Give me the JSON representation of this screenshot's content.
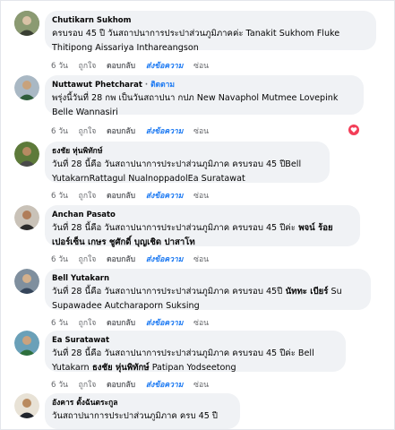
{
  "comments": [
    {
      "name": "Chutikarn Sukhom",
      "follow": "",
      "line1": "ครบรอบ 45 ปี วันสถาปนาการประปาส่วนภูมิภาคค่ะ Tanakit Sukhom Fluke",
      "line2": "Thitipong Aissariya Inthareangson",
      "time": "6 วัน",
      "like": "ถูกใจ",
      "reply": "ตอบกลับ",
      "share": "ส่งข้อความ",
      "hide": "ซ่อน"
    },
    {
      "name": "Nuttawut Phetcharat",
      "follow": "ติดตาม",
      "line1": "พรุ่งนี้วันที่ 28 กพ เป็นวันสถาปนา กปภ New Navaphol Mutmee Lovepink",
      "line2": "Belle Wannasiri",
      "time": "6 วัน",
      "like": "ถูกใจ",
      "reply": "ตอบกลับ",
      "share": "ส่งข้อความ",
      "hide": "ซ่อน"
    },
    {
      "name": "ธงชัย หุ่นพิทักษ์",
      "follow": "",
      "line1": "วันที่ 28 นี้คือ วันสถาปนาการประปาส่วนภูมิภาค ครบรอบ 45 ปีBell",
      "line2": "YutakarnRattagul NualnoppadolEa Suratawat",
      "time": "6 วัน",
      "like": "ถูกใจ",
      "reply": "ตอบกลับ",
      "share": "ส่งข้อความ",
      "hide": "ซ่อน"
    },
    {
      "name": "Anchan Pasato",
      "follow": "",
      "line1": "วันที่ 28 นี้คือ วันสถาปนาการประปาส่วนภูมิภาค ครบรอบ 45 ปีค่ะ",
      "line1_bold": " พจน์ ร้อย",
      "line2": "เปอร์เซ็น เกษร ชูศักดิ์ บุญเชิด ปาสาโท",
      "time": "6 วัน",
      "like": "ถูกใจ",
      "reply": "ตอบกลับ",
      "share": "ส่งข้อความ",
      "hide": "ซ่อน"
    },
    {
      "name": "Bell Yutakarn",
      "follow": "",
      "line1": "วันที่ 28 นี้คือ วันสถาปนาการประปาส่วนภูมิภาค ครบรอบ 45ปี",
      "line1_bold": " นัททะ เบียร์",
      "line1_tail": " Su",
      "line2": "Supawadee Autcharaporn Suksing",
      "time": "6 วัน",
      "like": "ถูกใจ",
      "reply": "ตอบกลับ",
      "share": "ส่งข้อความ",
      "hide": "ซ่อน"
    },
    {
      "name": "Ea Suratawat",
      "follow": "",
      "line1": "วันที่ 28 นี้คือ วันสถาปนาการประปาส่วนภูมิภาค ครบรอบ 45 ปีค่ะ Bell",
      "line2": "Yutakarn",
      "line2_bold": " ธงชัย หุ่นพิทักษ์",
      "line2_tail": " Patipan Yodseetong",
      "time": "6 วัน",
      "like": "ถูกใจ",
      "reply": "ตอบกลับ",
      "share": "ส่งข้อความ",
      "hide": "ซ่อน"
    },
    {
      "name": "อังคาร ตั้งฉันตระกูล",
      "follow": "",
      "line1": "วันสถาปนาการประปาส่วนภูมิภาค ครบ 45 ปี",
      "line2": ""
    }
  ],
  "colors": {
    "bubble": "#f0f2f5",
    "share_link": "#1877f2",
    "heart_reaction": "#f33e58"
  },
  "icons": [
    "user-avatar",
    "heart-reaction-icon"
  ]
}
